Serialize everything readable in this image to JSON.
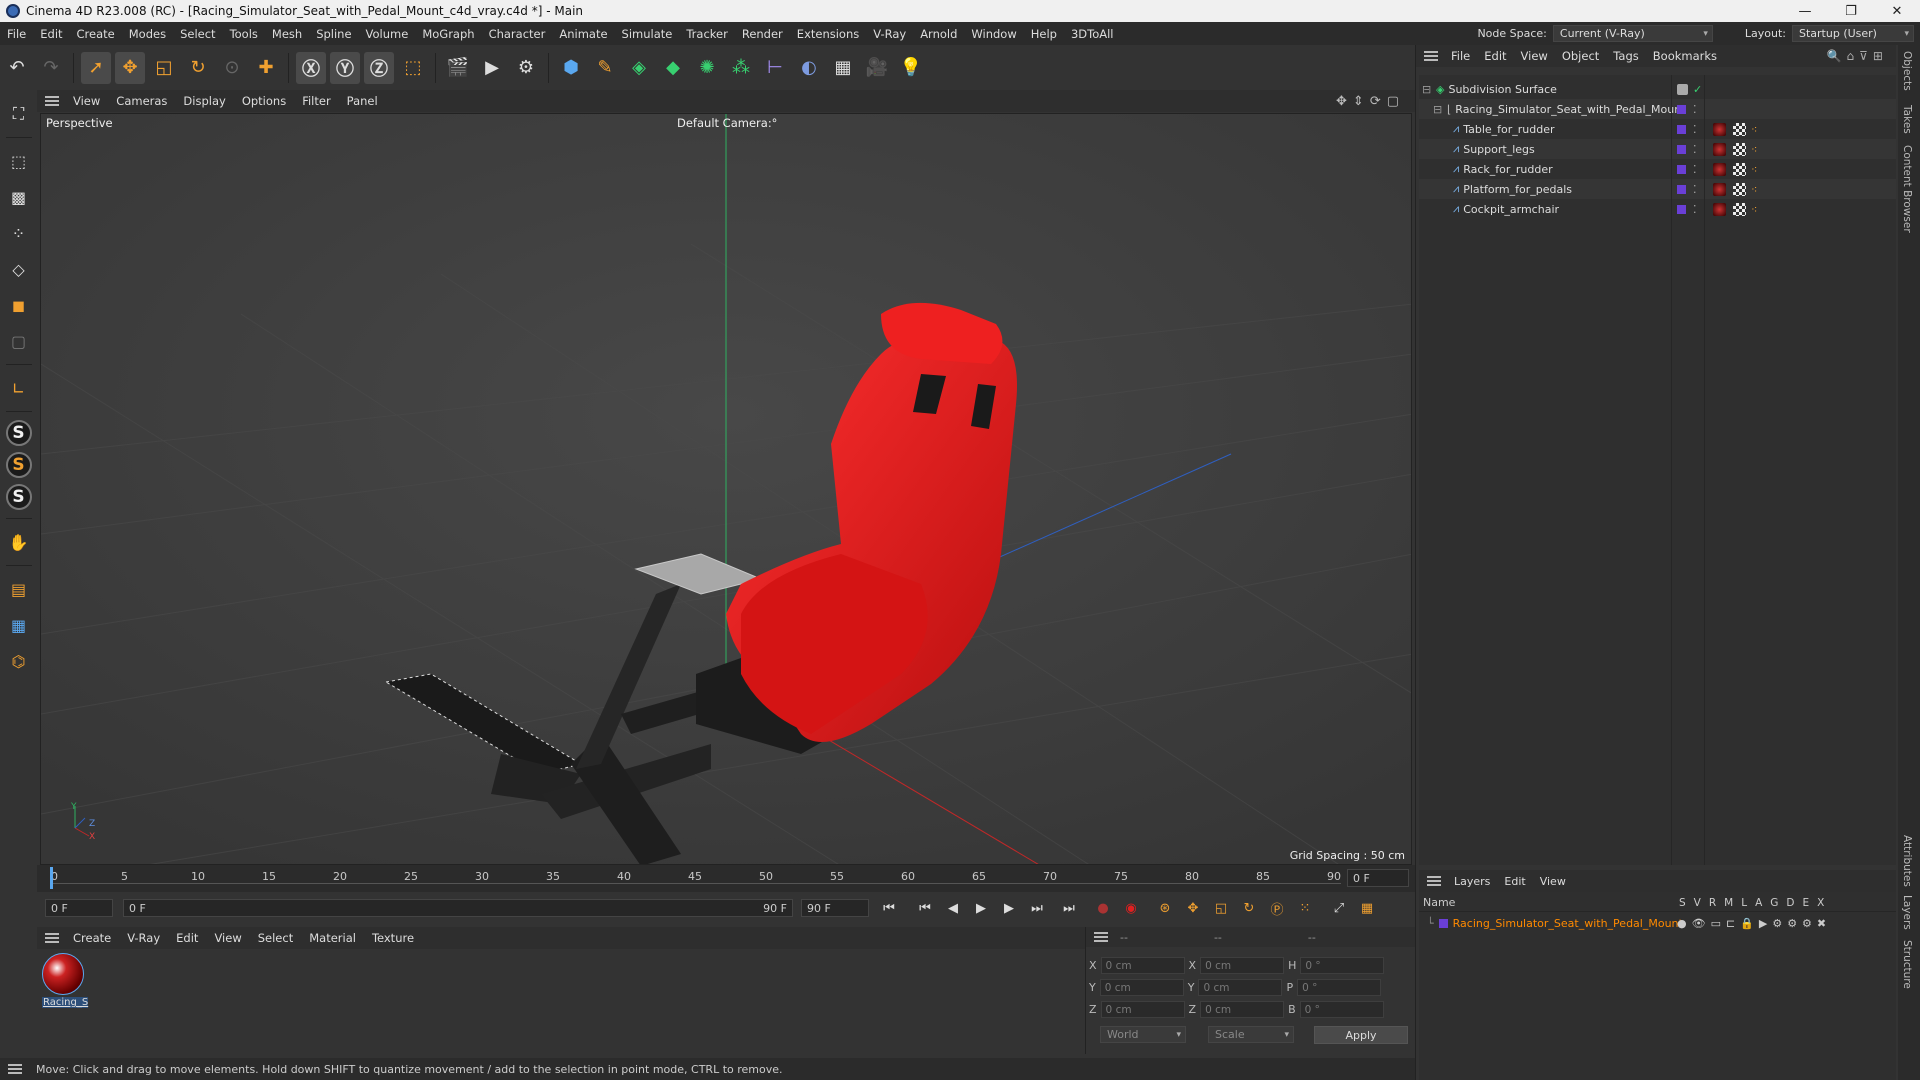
{
  "titlebar": {
    "title": "Cinema 4D R23.008 (RC) - [Racing_Simulator_Seat_with_Pedal_Mount_c4d_vray.c4d *] - Main",
    "minimize": "—",
    "maximize": "❐",
    "close": "✕"
  },
  "menubar": {
    "items": [
      "File",
      "Edit",
      "Create",
      "Modes",
      "Select",
      "Tools",
      "Mesh",
      "Spline",
      "Volume",
      "MoGraph",
      "Character",
      "Animate",
      "Simulate",
      "Tracker",
      "Render",
      "Extensions",
      "V-Ray",
      "Arnold",
      "Window",
      "Help",
      "3DToAll"
    ],
    "node_space_label": "Node Space:",
    "node_space_value": "Current (V-Ray)",
    "layout_label": "Layout:",
    "layout_value": "Startup (User)"
  },
  "viewport": {
    "menu": [
      "View",
      "Cameras",
      "Display",
      "Options",
      "Filter",
      "Panel"
    ],
    "projection": "Perspective",
    "camera": "Default Camera",
    "camera_suffix": ":°",
    "grid_spacing": "Grid Spacing : 50 cm",
    "axis_y": "Y",
    "axis_z": "Z",
    "axis_x": "X"
  },
  "timeline": {
    "ticks": [
      "0",
      "5",
      "10",
      "15",
      "20",
      "25",
      "30",
      "35",
      "40",
      "45",
      "50",
      "55",
      "60",
      "65",
      "70",
      "75",
      "80",
      "85",
      "90"
    ],
    "current_frame_field": "0 F",
    "start_field": "0 F",
    "range_start": "0 F",
    "range_end": "90 F",
    "end_field": "90 F"
  },
  "material_manager": {
    "menu": [
      "Create",
      "V-Ray",
      "Edit",
      "View",
      "Select",
      "Material",
      "Texture"
    ],
    "material_name": "Racing_S"
  },
  "coordinates": {
    "header": [
      "--",
      "--",
      "--"
    ],
    "rows": [
      {
        "a": "X",
        "av": "0 cm",
        "b": "X",
        "bv": "0 cm",
        "c": "H",
        "cv": "0 °"
      },
      {
        "a": "Y",
        "av": "0 cm",
        "b": "Y",
        "bv": "0 cm",
        "c": "P",
        "cv": "0 °"
      },
      {
        "a": "Z",
        "av": "0 cm",
        "b": "Z",
        "bv": "0 cm",
        "c": "B",
        "cv": "0 °"
      }
    ],
    "mode_world": "World",
    "mode_scale": "Scale",
    "apply": "Apply"
  },
  "status": {
    "text": "Move: Click and drag to move elements. Hold down SHIFT to quantize movement / add to the selection in point mode, CTRL to remove."
  },
  "object_manager": {
    "menu": [
      "File",
      "Edit",
      "View",
      "Object",
      "Tags",
      "Bookmarks"
    ],
    "objects": [
      {
        "name": "Subdivision Surface",
        "indent": 0
      },
      {
        "name": "Racing_Simulator_Seat_with_Pedal_Mount",
        "indent": 1
      },
      {
        "name": "Table_for_rudder",
        "indent": 2
      },
      {
        "name": "Support_legs",
        "indent": 2
      },
      {
        "name": "Rack_for_rudder",
        "indent": 2
      },
      {
        "name": "Platform_for_pedals",
        "indent": 2
      },
      {
        "name": "Cockpit_armchair",
        "indent": 2
      }
    ]
  },
  "layer_manager": {
    "menu": [
      "Layers",
      "Edit",
      "View"
    ],
    "name_header": "Name",
    "flag_headers": [
      "S",
      "V",
      "R",
      "M",
      "L",
      "A",
      "G",
      "D",
      "E",
      "X"
    ],
    "layer_name": "Racing_Simulator_Seat_with_Pedal_Mount",
    "layer_color": "#ff8a00"
  },
  "side_tabs": [
    "Objects",
    "Takes",
    "Content Browser",
    "Attributes",
    "Layers",
    "Structure"
  ],
  "colors": {
    "accent_orange": "#f0a030",
    "seat_red": "#e01818",
    "layer_purple": "#6a3fd6"
  }
}
